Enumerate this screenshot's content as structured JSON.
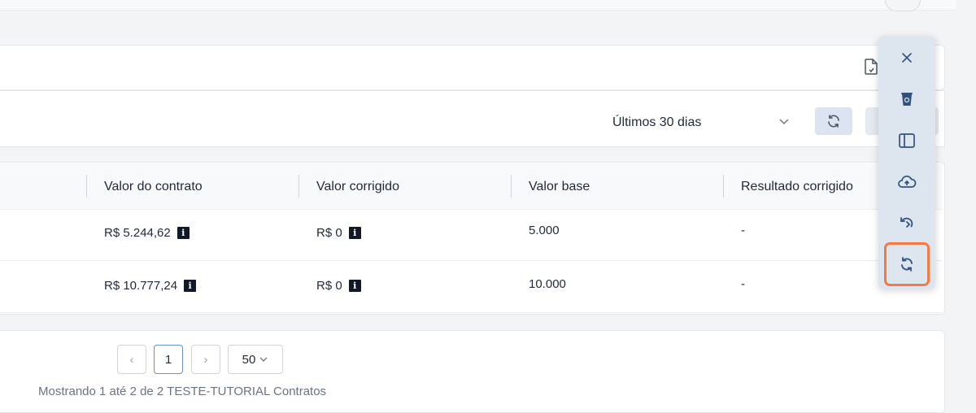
{
  "filters": {
    "period_value": "Últimos 30 dias"
  },
  "table": {
    "columns": [
      "Valor do contrato",
      "Valor corrigido",
      "Valor base",
      "Resultado corrigido"
    ],
    "rows": [
      {
        "valor_contrato": "R$ 5.244,62",
        "valor_corrigido": "R$ 0",
        "valor_base": "5.000",
        "resultado_corrigido": "-"
      },
      {
        "valor_contrato": "R$ 10.777,24",
        "valor_corrigido": "R$ 0",
        "valor_base": "10.000",
        "resultado_corrigido": "-"
      }
    ],
    "info_glyph": "i"
  },
  "pagination": {
    "prev_glyph": "‹",
    "current_page": "1",
    "next_glyph": "›",
    "page_size": "50",
    "summary": "Mostrando 1 até 2 de 2 TESTE-TUTORIAL Contratos"
  },
  "toolbar": {
    "items": [
      "close-icon",
      "recycle-bin-icon",
      "sidebar-layout-icon",
      "cloud-upload-icon",
      "restore-icon",
      "sync-icon"
    ],
    "active_item": "sync-icon",
    "highlight_color": "#f47a42"
  }
}
